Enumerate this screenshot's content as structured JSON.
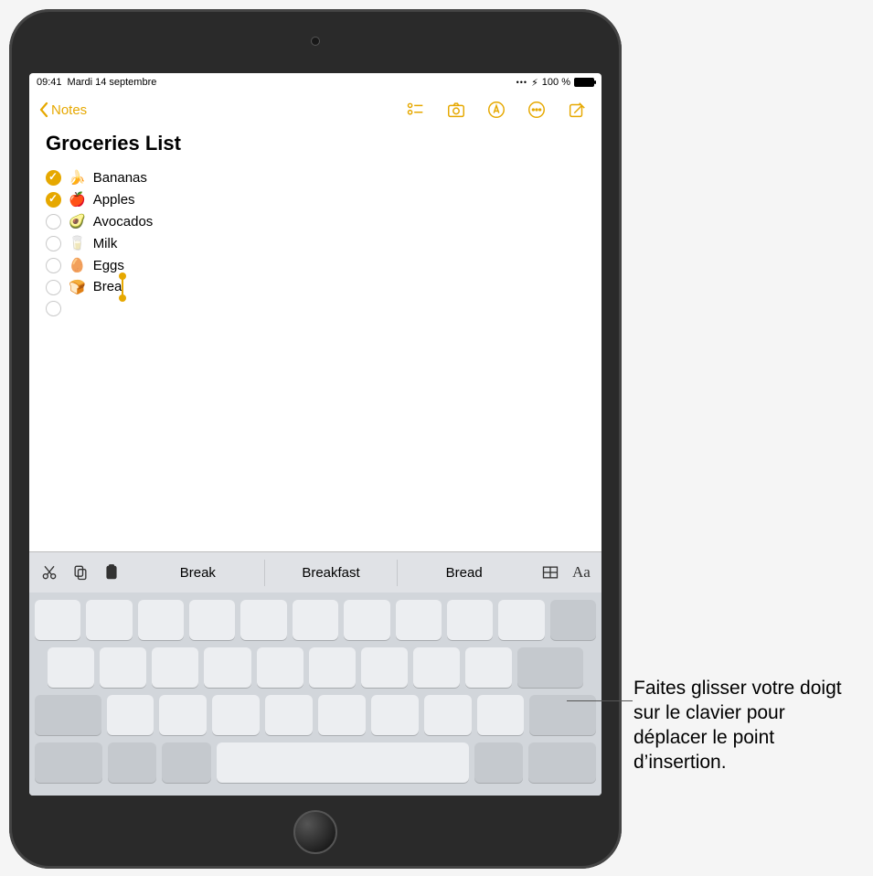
{
  "status": {
    "time": "09:41",
    "date": "Mardi 14 septembre",
    "battery": "100 %",
    "charging_glyph": "⚡︎"
  },
  "nav": {
    "back_label": "Notes"
  },
  "note": {
    "title": "Groceries List",
    "items": [
      {
        "checked": true,
        "emoji": "🍌",
        "text": "Bananas",
        "cursor": false
      },
      {
        "checked": true,
        "emoji": "🍎",
        "text": "Apples",
        "cursor": false
      },
      {
        "checked": false,
        "emoji": "🥑",
        "text": "Avocados",
        "cursor": false
      },
      {
        "checked": false,
        "emoji": "🥛",
        "text": "Milk",
        "cursor": false
      },
      {
        "checked": false,
        "emoji": "🥚",
        "text": "Eggs",
        "cursor": false
      },
      {
        "checked": false,
        "emoji": "🍞",
        "text": "Brea",
        "cursor": true
      },
      {
        "checked": false,
        "emoji": "",
        "text": "",
        "cursor": false
      }
    ]
  },
  "predictive": {
    "words": [
      "Break",
      "Breakfast",
      "Bread"
    ]
  },
  "annotation": {
    "text": "Faites glisser votre doigt sur le clavier pour déplacer le point d’insertion."
  },
  "colors": {
    "accent": "#e6a800"
  }
}
